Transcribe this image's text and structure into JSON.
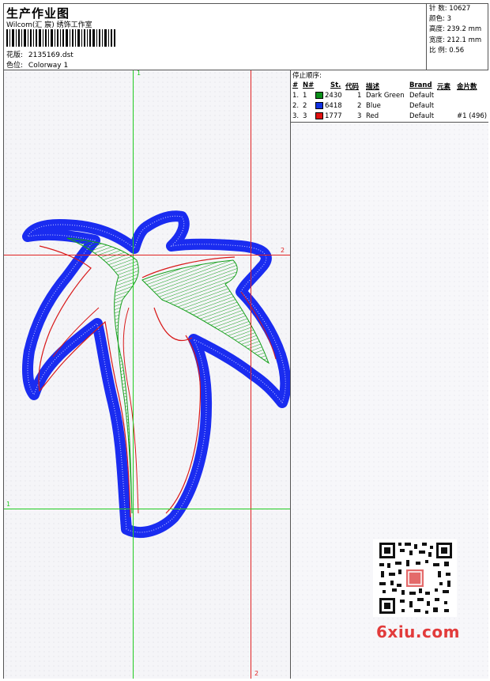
{
  "header": {
    "title": "生产作业图",
    "studio": "Wilcom(汇 宸) 绣饰工作室",
    "design_label": "花版:",
    "design_value": "2135169.dst",
    "colorway_label": "色位:",
    "colorway_value": "Colorway 1"
  },
  "stats": [
    {
      "label": "针 数:",
      "value": "10627"
    },
    {
      "label": "颜色:",
      "value": "3"
    },
    {
      "label": "高度:",
      "value": "239.2 mm"
    },
    {
      "label": "宽度:",
      "value": "212.1 mm"
    },
    {
      "label": "比 例:",
      "value": "0.56"
    }
  ],
  "stop_sequence": {
    "title": "停止顺序:",
    "columns": [
      "#",
      "N#",
      "St.",
      "代码",
      "描述",
      "Brand",
      "元素",
      "金片数"
    ],
    "rows": [
      {
        "num": "1.",
        "n": "1",
        "swatch": "#0b8f1a",
        "stitches": "2430",
        "code": "1",
        "desc": "Dark Green",
        "brand": "Default",
        "elements": "",
        "sequins": ""
      },
      {
        "num": "2.",
        "n": "2",
        "swatch": "#1030e0",
        "stitches": "6418",
        "code": "2",
        "desc": "Blue",
        "brand": "Default",
        "elements": "",
        "sequins": ""
      },
      {
        "num": "3.",
        "n": "3",
        "swatch": "#e01010",
        "stitches": "1777",
        "code": "3",
        "desc": "Red",
        "brand": "Default",
        "elements": "#1 (496)",
        "sequins": ""
      }
    ]
  },
  "guides": {
    "v1_label": "1",
    "v2_label": "2",
    "h1_label": "1",
    "h2_label": "2"
  },
  "colors": {
    "green_guide": "#22cc22",
    "red_guide": "#e02020",
    "blue_thread": "#1a2cf0",
    "green_thread": "#16a01c",
    "red_thread": "#d81818"
  },
  "watermark": "6xiu.com"
}
